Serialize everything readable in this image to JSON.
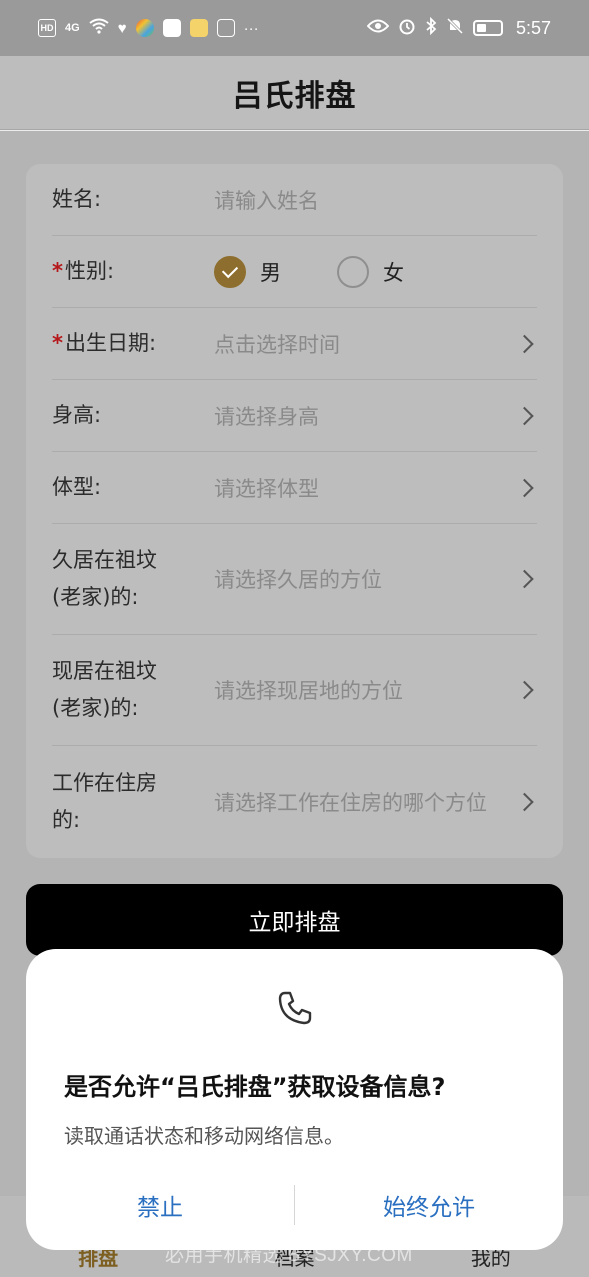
{
  "status_bar": {
    "network": "HD",
    "signal": "4G",
    "time": "5:57"
  },
  "header": {
    "title": "吕氏排盘"
  },
  "form": {
    "name": {
      "label": "姓名:",
      "placeholder": "请输入姓名"
    },
    "gender": {
      "required_mark": "*",
      "label": "性别:",
      "options": [
        "男",
        "女"
      ],
      "selected": "男"
    },
    "birth": {
      "required_mark": "*",
      "label": "出生日期:",
      "placeholder": "点击选择时间"
    },
    "height": {
      "label": "身高:",
      "placeholder": "请选择身高"
    },
    "body_type": {
      "label": "体型:",
      "placeholder": "请选择体型"
    },
    "long_residence": {
      "label_line1": "久居在祖坟",
      "label_line2": "(老家)的:",
      "placeholder": "请选择久居的方位"
    },
    "current_residence": {
      "label_line1": "现居在祖坟",
      "label_line2": "(老家)的:",
      "placeholder": "请选择现居地的方位"
    },
    "work": {
      "label_line1": "工作在住房",
      "label_line2": "的:",
      "placeholder": "请选择工作在住房的哪个方位"
    }
  },
  "submit_label": "立即排盘",
  "bottom_nav": {
    "items": [
      "排盘",
      "档案",
      "我的"
    ],
    "active": "排盘"
  },
  "watermark": "必用手机精选 BYSJXY.COM",
  "dialog": {
    "icon": "phone-icon",
    "title": "是否允许“吕氏排盘”获取设备信息?",
    "message": "读取通话状态和移动网络信息。",
    "deny_label": "禁止",
    "allow_label": "始终允许"
  },
  "colors": {
    "accent": "#8e6e2e",
    "required": "#b5171a",
    "dialog_button": "#2a6fc0"
  }
}
